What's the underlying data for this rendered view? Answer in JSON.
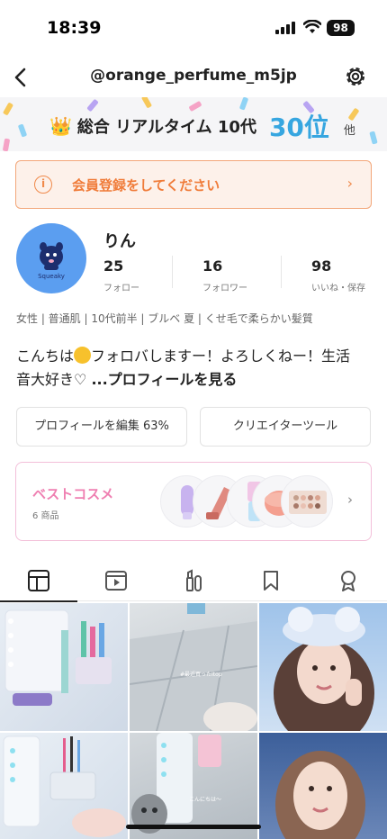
{
  "status_bar": {
    "time": "18:39",
    "battery": "98"
  },
  "nav": {
    "username": "@orange_perfume_m5jp"
  },
  "ranking": {
    "label": "総合 リアルタイム 10代",
    "rank": "30位",
    "suffix": "他"
  },
  "member_banner": {
    "text": "会員登録をしてください"
  },
  "profile": {
    "name": "りん",
    "avatar_text": "Squeaky",
    "stats": [
      {
        "value": "25",
        "label": "フォロー"
      },
      {
        "value": "16",
        "label": "フォロワー"
      },
      {
        "value": "98",
        "label": "いいね・保存"
      }
    ],
    "tags": "女性 | 普通肌 | 10代前半 | ブルベ 夏 | くせ毛で柔らかい髪質",
    "bio_line1_pre": "こんちは",
    "bio_line1_post": "フォロバしますー！よろしくねー！生活",
    "bio_line2": "音大好き♡ ",
    "bio_more": "...プロフィールを見る"
  },
  "buttons": {
    "edit_profile": "プロフィールを編集 63%",
    "creator_tools": "クリエイターツール"
  },
  "best_cosme": {
    "title": "ベストコスメ",
    "count": "6 商品"
  },
  "tabs": [
    "grid-icon",
    "video-icon",
    "cosmetics-icon",
    "bookmark-icon",
    "award-icon"
  ],
  "grid_captions": {
    "tile5": "#最近買ったItop",
    "tile6": "こんにちは〜"
  },
  "colors": {
    "accent_blue": "#37a6e0",
    "accent_orange": "#f07c3a",
    "accent_pink": "#ef7fb1"
  }
}
